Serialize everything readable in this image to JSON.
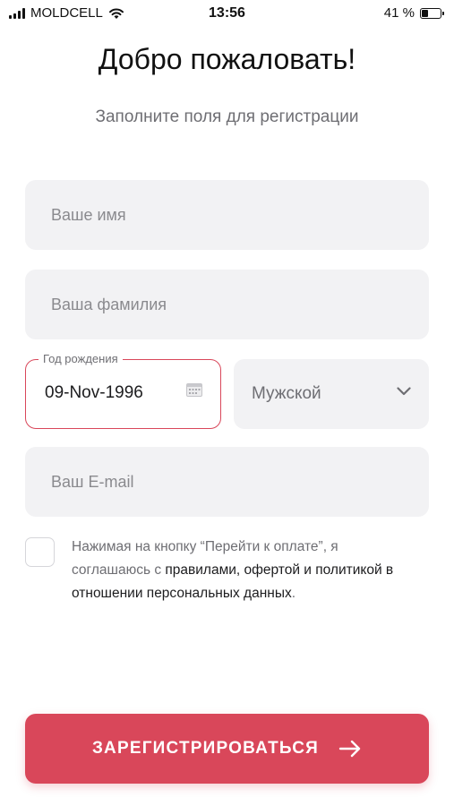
{
  "status_bar": {
    "carrier": "MOLDCELL",
    "time": "13:56",
    "battery_percent_label": "41 %",
    "battery_level": 0.41
  },
  "header": {
    "title": "Добро пожаловать!",
    "subtitle": "Заполните поля для регистрации"
  },
  "form": {
    "first_name": {
      "placeholder": "Ваше имя",
      "value": ""
    },
    "last_name": {
      "placeholder": "Ваша фамилия",
      "value": ""
    },
    "birth_date": {
      "label": "Год рождения",
      "value": "09-Nov-1996",
      "icon": "calendar-icon"
    },
    "gender": {
      "selected": "Мужской",
      "icon": "chevron-down-icon"
    },
    "email": {
      "placeholder": "Ваш E-mail",
      "value": ""
    }
  },
  "consent": {
    "checked": false,
    "text_before": "Нажимая на кнопку “Перейти к оплате”, я соглашаюсь с ",
    "link_text": "правилами, офертой и политикой в отношении персональных данных",
    "text_after": "."
  },
  "register_button": {
    "label": "ЗАРЕГИСТРИРОВАТЬСЯ",
    "icon": "arrow-right-icon"
  },
  "colors": {
    "accent": "#d9475a",
    "field_bg": "#f2f2f4",
    "muted_text": "#6e6e73"
  }
}
